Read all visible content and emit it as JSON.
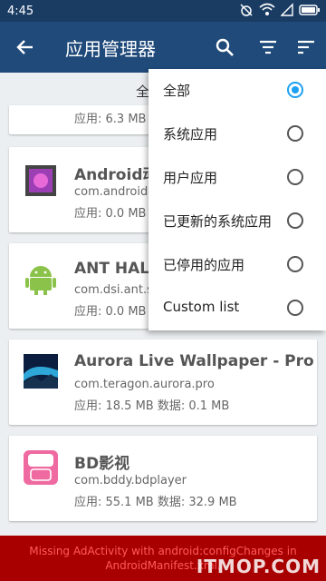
{
  "status": {
    "time": "4:45"
  },
  "appbar": {
    "title": "应用管理器"
  },
  "list": {
    "section_header": "全部应用",
    "partial_size": "应用: 6.3 MB",
    "apps": [
      {
        "name": "Android动态壁纸",
        "package": "com.android.wallpaper",
        "size": "应用: 0.0 MB"
      },
      {
        "name": "ANT HAL Service",
        "package": "com.dsi.ant.server",
        "size": "应用: 0.0 MB"
      },
      {
        "name": "Aurora Live Wallpaper - Pro",
        "package": "com.teragon.aurora.pro",
        "size": "应用: 18.5 MB    数据: 0.1 MB"
      },
      {
        "name": "BD影视",
        "package": "com.bddy.bdplayer",
        "size": "应用: 55.1 MB    数据: 32.9 MB"
      }
    ]
  },
  "filter_menu": {
    "items": [
      {
        "label": "全部",
        "checked": true
      },
      {
        "label": "系统应用",
        "checked": false
      },
      {
        "label": "用户应用",
        "checked": false
      },
      {
        "label": "已更新的系统应用",
        "checked": false
      },
      {
        "label": "已停用的应用",
        "checked": false
      },
      {
        "label": "Custom list",
        "checked": false
      }
    ]
  },
  "error_banner": "Missing AdActivity with android:configChanges in AndroidManifest.xml.",
  "watermark": "ITMOP.COM",
  "colors": {
    "appbar": "#1f4a7a",
    "statusbar": "#1a3c63",
    "accent": "#1da1f2",
    "error_bg": "#a80000"
  }
}
